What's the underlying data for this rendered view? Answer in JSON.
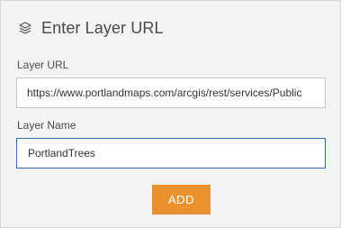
{
  "header": {
    "title": "Enter Layer URL",
    "icon": "layers-icon"
  },
  "fields": {
    "url": {
      "label": "Layer URL",
      "value": "https://www.portlandmaps.com/arcgis/rest/services/Public"
    },
    "name": {
      "label": "Layer Name",
      "value": "PortlandTrees"
    }
  },
  "actions": {
    "add_label": "ADD"
  },
  "colors": {
    "accent": "#e8912e",
    "focus_border": "#2f6fb1",
    "panel_bg": "#f3f3f3"
  }
}
